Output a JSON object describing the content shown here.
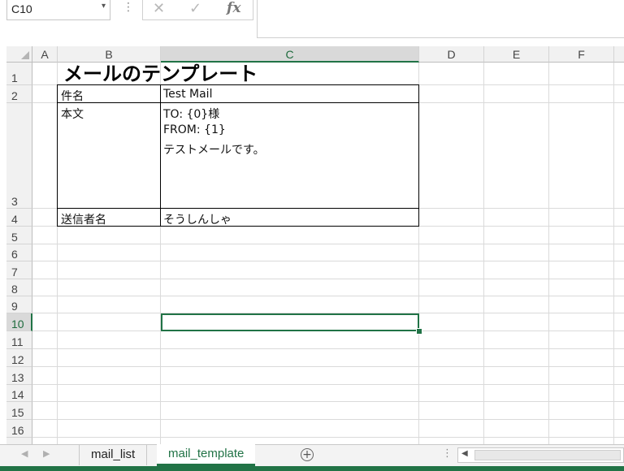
{
  "formula_bar": {
    "name_box": "C10",
    "cancel_icon": "✕",
    "enter_icon": "✓",
    "fx_label": "fx",
    "formula": ""
  },
  "columns": [
    "A",
    "B",
    "C",
    "D",
    "E",
    "F"
  ],
  "selected_column": "C",
  "rows": [
    "1",
    "2",
    "3",
    "4",
    "5",
    "6",
    "7",
    "8",
    "9",
    "10",
    "11",
    "12",
    "13",
    "14",
    "15",
    "16"
  ],
  "selected_row": "10",
  "cells": {
    "B1": "メールのテンプレート",
    "B2": "件名",
    "C2": "Test Mail",
    "B3": "本文",
    "C3_line1": "TO: {0}様",
    "C3_line2": "FROM: {1}",
    "C3_line3": "テストメールです。",
    "B4": "送信者名",
    "C4": "そうしんしゃ"
  },
  "sheet_tabs": [
    {
      "label": "mail_list",
      "active": false
    },
    {
      "label": "mail_template",
      "active": true
    }
  ],
  "colors": {
    "accent": "#217346",
    "header_bg": "#f1f1f1",
    "gridline": "#dadada"
  }
}
